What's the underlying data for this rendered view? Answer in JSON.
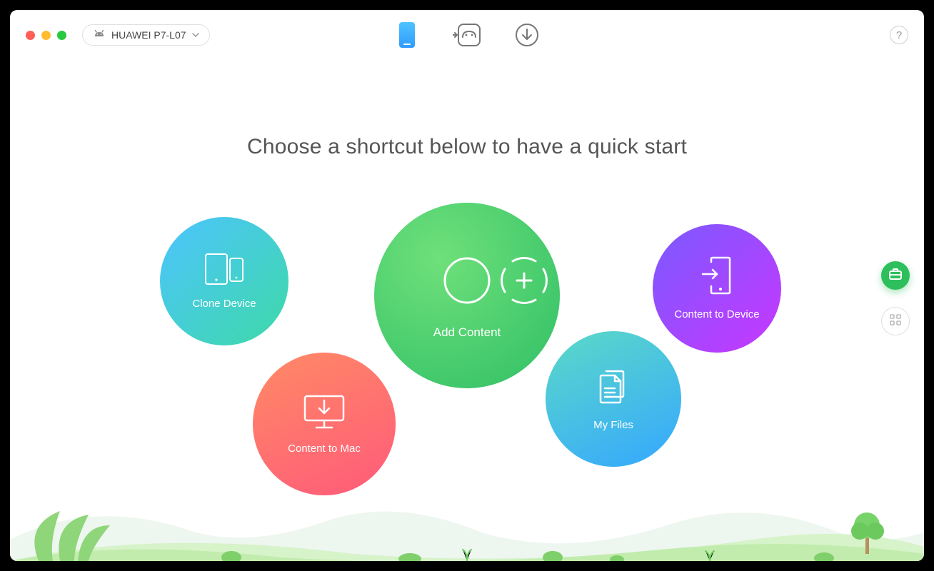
{
  "device": {
    "name": "HUAWEI P7-L07"
  },
  "heading": "Choose a shortcut below to have a quick start",
  "shortcuts": {
    "clone_device": "Clone Device",
    "add_content": "Add Content",
    "content_to_device": "Content to Device",
    "content_to_mac": "Content to Mac",
    "my_files": "My Files"
  },
  "help_label": "?"
}
